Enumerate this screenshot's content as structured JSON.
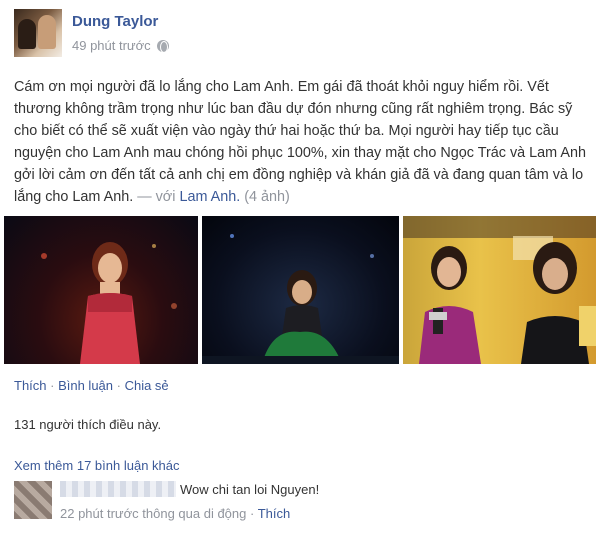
{
  "post": {
    "author": "Dung Taylor",
    "time": "49 phút trước",
    "privacy_icon": "globe-icon",
    "text_main": "Cám ơn mọi người đã lo lắng cho Lam Anh. Em gái đã thoát khỏi nguy hiểm rồi. Vết thương không trầm trọng như lúc ban đầu dự đón nhưng cũng rất nghiêm trọng. Bác sỹ cho biết có thể sẽ xuất viện vào ngày thứ hai hoặc thứ ba. Mọi người hay tiếp tục cầu nguyện cho Lam Anh mau chóng hồi phục 100%, xin thay mặt cho Ngọc Trác và Lam Anh gởi lời cảm ơn đến tất cả anh chị em đồng nghiệp và khán giả đã và đang quan tâm và lo lắng cho Lam Anh.",
    "tag_prefix": " — với ",
    "tagged": "Lam Anh.",
    "photo_count": "(4 ảnh)"
  },
  "actions": {
    "like": "Thích",
    "comment": "Bình luận",
    "share": "Chia sẻ",
    "sep": " · "
  },
  "likes_summary": "131 người thích điều này.",
  "more_comments": "Xem thêm 17 bình luận khác",
  "comment": {
    "text": "Wow chi tan loi Nguyen!",
    "time_meta": "22 phút trước thông qua di động · ",
    "like": "Thích"
  }
}
